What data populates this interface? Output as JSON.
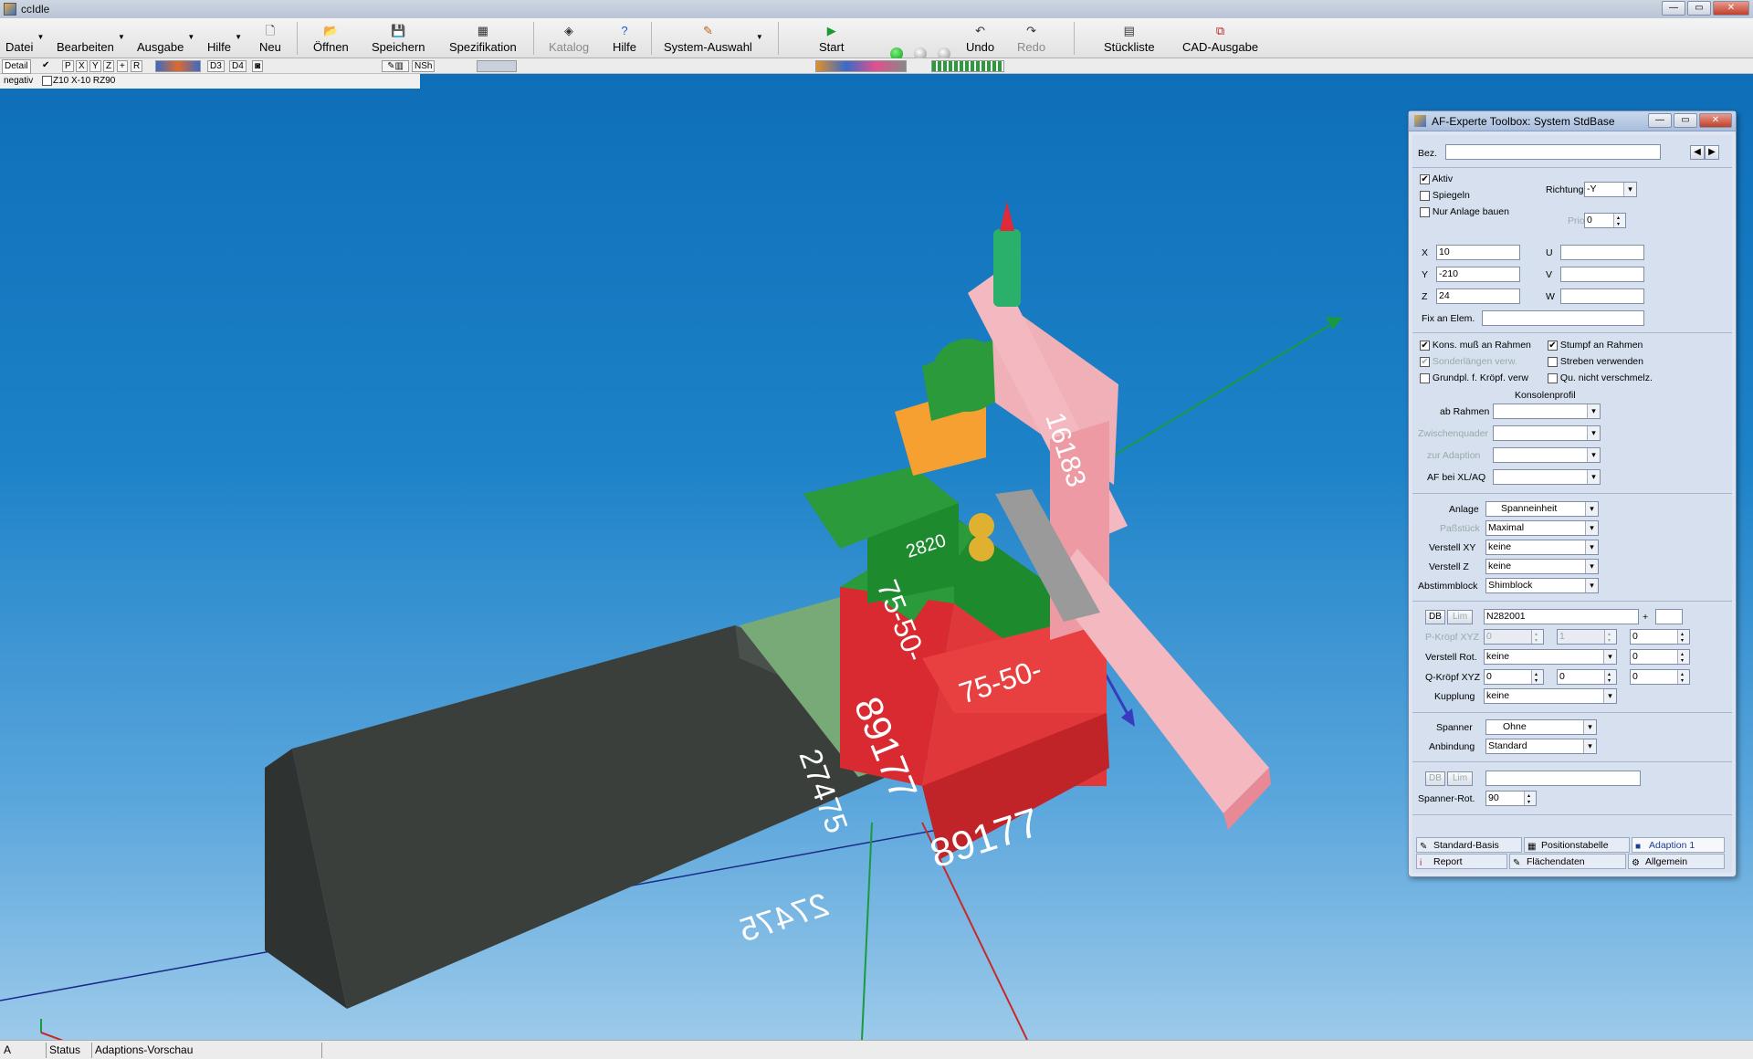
{
  "window": {
    "title": "ccIdle"
  },
  "toolbar": {
    "datei": "Datei",
    "bearbeiten": "Bearbeiten",
    "ausgabe": "Ausgabe",
    "hilfe_menu": "Hilfe",
    "neu": "Neu",
    "oeffnen": "Öffnen",
    "speichern": "Speichern",
    "spezifikation": "Spezifikation",
    "katalog": "Katalog",
    "hilfe": "Hilfe",
    "system_auswahl": "System-Auswahl",
    "start": "Start",
    "undo": "Undo",
    "redo": "Redo",
    "stueckliste": "Stückliste",
    "cad_ausgabe": "CAD-Ausgabe"
  },
  "toolbar2": {
    "p": "P",
    "x": "X",
    "y": "Y",
    "z": "Z",
    "plus": "+",
    "r": "R",
    "d3": "D3",
    "d4": "D4",
    "nsh": "NSh"
  },
  "infopanel": {
    "detail": "Detail",
    "negativ": "negativ",
    "coords": "Z10 X-10 RZ90"
  },
  "viewport_labels": {
    "cube_front": "89177",
    "cube_side": "89177",
    "green_block_side": "75-50-",
    "green_block_front": "75-50-",
    "plate": "2820",
    "pink_bar": "16183",
    "frame": "27475",
    "light_green": "27475"
  },
  "status": {
    "a": "A",
    "status": "Status",
    "vorschau": "Adaptions-Vorschau"
  },
  "toolbox": {
    "title": "AF-Experte Toolbox: System StdBase",
    "bez_label": "Bez.",
    "bez_value": "",
    "aktiv": "Aktiv",
    "spiegeln": "Spiegeln",
    "nur_anlage": "Nur Anlage bauen",
    "richtung_label": "Richtung",
    "richtung_value": "-Y",
    "prio_label": "Prio",
    "prio_value": "0",
    "x_label": "X",
    "x_value": "10",
    "y_label": "Y",
    "y_value": "-210",
    "z_label": "Z",
    "z_value": "24",
    "u_label": "U",
    "v_label": "V",
    "w_label": "W",
    "fix_label": "Fix an Elem.",
    "kons_rahmen": "Kons. muß an Rahmen",
    "stumpf": "Stumpf an Rahmen",
    "sonderlaengen": "Sonderlängen verw.",
    "streben": "Streben verwenden",
    "grundpl": "Grundpl. f. Kröpf. verw",
    "qu_nicht": "Qu. nicht verschmelz.",
    "konsolenprofil": "Konsolenprofil",
    "ab_rahmen": "ab Rahmen",
    "zwischenquader": "Zwischenquader",
    "zur_adaption": "zur Adaption",
    "af_xl": "AF bei XL/AQ",
    "anlage_label": "Anlage",
    "anlage_value": "Spanneinheit",
    "passstueck_label": "Paßstück",
    "passstueck_value": "Maximal",
    "verstell_xy_label": "Verstell XY",
    "verstell_xy_value": "keine",
    "verstell_z_label": "Verstell  Z",
    "verstell_z_value": "keine",
    "abstimm_label": "Abstimmblock",
    "abstimm_value": "Shimblock",
    "db": "DB",
    "lim": "Lim",
    "n_value": "N282001",
    "plus": "+",
    "pkroepf_label": "P-Kröpf XYZ",
    "pk1": "0",
    "pk2": "1",
    "pk3": "0",
    "verstell_rot_label": "Verstell Rot.",
    "verstell_rot_value": "keine",
    "vr2": "0",
    "qkroepf_label": "Q-Kröpf XYZ",
    "qk1": "0",
    "qk2": "0",
    "qk3": "0",
    "kupplung_label": "Kupplung",
    "kupplung_value": "keine",
    "spanner_label": "Spanner",
    "spanner_value": "Ohne",
    "anbindung_label": "Anbindung",
    "anbindung_value": "Standard",
    "db2": "DB",
    "lim2": "Lim",
    "spanner_rot_label": "Spanner-Rot.",
    "spanner_rot_value": "90",
    "tabs": {
      "standard": "Standard-Basis",
      "positionstabelle": "Positionstabelle",
      "adaption": "Adaption 1",
      "report": "Report",
      "flaechendaten": "Flächendaten",
      "allgemein": "Allgemein"
    }
  }
}
